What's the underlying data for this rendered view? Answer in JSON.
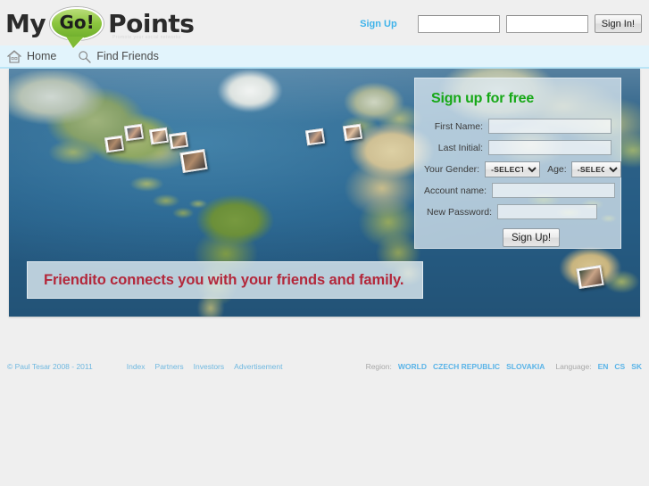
{
  "header": {
    "logo": {
      "word_my": "My",
      "bubble_text": "Go!",
      "word_points": "Points",
      "tagline": "Promote your social networks"
    },
    "auth": {
      "signup_link": "Sign Up",
      "username_value": "",
      "username_placeholder": "",
      "password_value": "",
      "password_placeholder": "",
      "signin_button": "Sign In!"
    }
  },
  "nav": {
    "items": [
      {
        "label": "Home",
        "icon": "home-icon"
      },
      {
        "label": "Find Friends",
        "icon": "search-icon"
      }
    ]
  },
  "hero": {
    "tagline": "Friendito connects you with your friends and family.",
    "map_alt": "world-map"
  },
  "signup": {
    "heading": "Sign up for free",
    "fields": {
      "first_name_label": "First Name:",
      "first_name_value": "",
      "last_initial_label": "Last Initial:",
      "last_initial_value": "",
      "gender_label": "Your Gender:",
      "gender_value": "-SELECT-",
      "age_label": "Age:",
      "age_value": "-SELECT-",
      "account_name_label": "Account name:",
      "account_name_value": "",
      "password_label": "New Password:",
      "password_value": ""
    },
    "submit_button": "Sign Up!"
  },
  "footer": {
    "copyright": "© Paul Tesar 2008 - 2011",
    "links": [
      "Index",
      "Partners",
      "Investors",
      "Advertisement"
    ],
    "region_label": "Region:",
    "regions": [
      "WORLD",
      "CZECH REPUBLIC",
      "SLOVAKIA"
    ],
    "language_label": "Language:",
    "languages": [
      "EN",
      "CS",
      "SK"
    ]
  },
  "colors": {
    "nav_bg": "#e2f4fc",
    "nav_border": "#b9e5f7",
    "link_blue": "#3fb3ea",
    "heading_green": "#16a816",
    "tagline_red": "#b3273a",
    "footer_link": "#6fb8e0",
    "page_bg": "#efefef"
  }
}
